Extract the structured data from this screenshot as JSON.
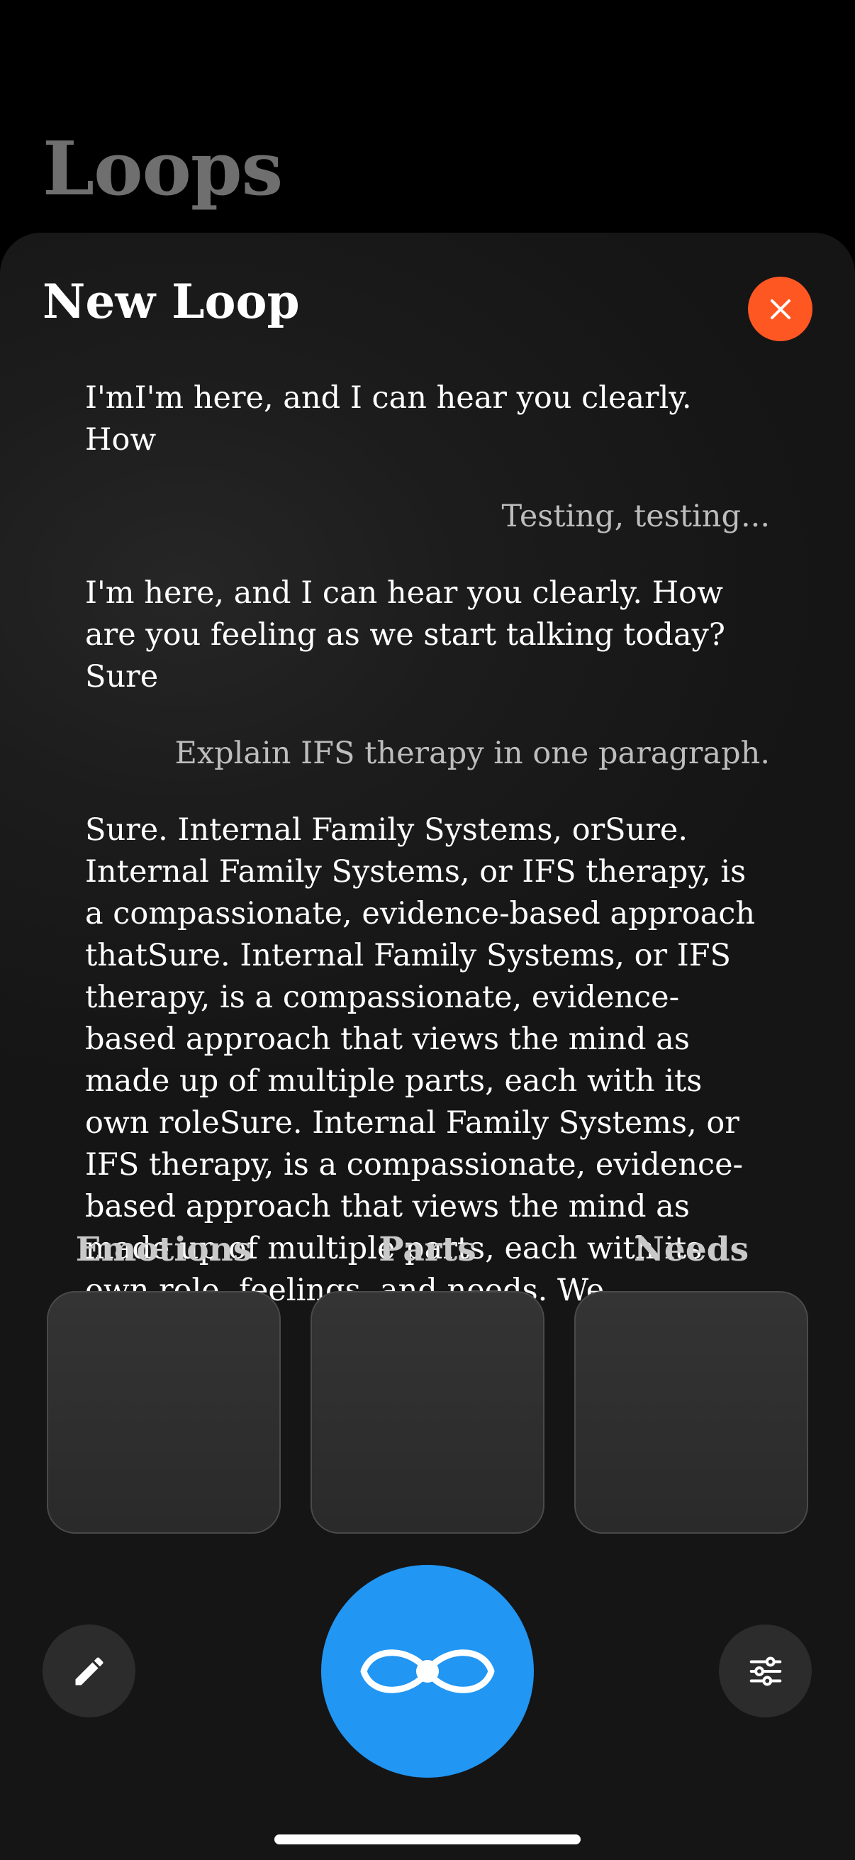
{
  "app": {
    "title": "Loops"
  },
  "sheet": {
    "title": "New Loop",
    "close_icon": "close-icon",
    "close_color": "#ff5722"
  },
  "transcript": {
    "messages": [
      {
        "role": "assistant",
        "text": "I'mI'm here, and I can hear you clearly. How"
      },
      {
        "role": "user",
        "text": "Testing, testing..."
      },
      {
        "role": "assistant",
        "text": "I'm here, and I can hear you clearly. How are you feeling as we start talking today?Sure"
      },
      {
        "role": "user",
        "text": "Explain IFS therapy in one paragraph."
      },
      {
        "role": "assistant",
        "text": "Sure. Internal Family Systems, orSure. Internal Family Systems, or IFS therapy, is a compassionate, evidence-based approach thatSure. Internal Family Systems, or IFS therapy, is a compassionate, evidence-based approach that views the mind as made up of multiple parts, each with its own roleSure. Internal Family Systems, or IFS therapy, is a compassionate, evidence-based approach that views the mind as made up of multiple parts, each with its own role, feelings, and needs. We"
      }
    ]
  },
  "columns": [
    {
      "label": "Emotions"
    },
    {
      "label": "Parts"
    },
    {
      "label": "Needs"
    }
  ],
  "controls": {
    "edit_icon": "pencil-icon",
    "main_icon": "infinity-loop-icon",
    "main_color": "#2196f3",
    "settings_icon": "sliders-icon"
  }
}
